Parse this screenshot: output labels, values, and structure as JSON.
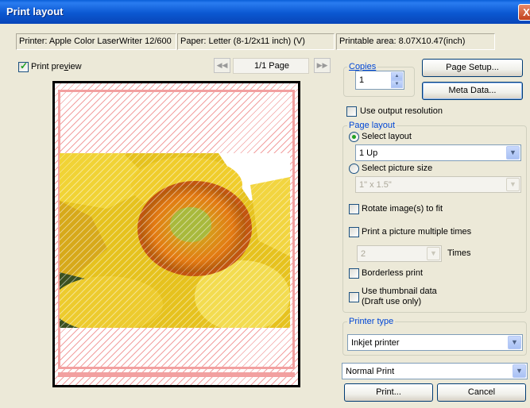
{
  "window": {
    "title": "Print layout",
    "close_glyph": "X"
  },
  "info": {
    "printer": "Printer: Apple Color LaserWriter 12/600",
    "paper": "Paper: Letter (8-1/2x11 inch) (V)",
    "printable": "Printable area: 8.07X10.47(inch)"
  },
  "preview": {
    "checkbox_label_prefix": "Print pre",
    "checkbox_label_u": "v",
    "checkbox_label_suffix": "iew",
    "checked": true,
    "page_indicator": "1/1 Page",
    "first_glyph": "◀◀",
    "next_glyph": "▶▶"
  },
  "copies": {
    "label": "Copies",
    "label_u": "C",
    "value": "1"
  },
  "buttons": {
    "page_setup": "Page Setup...",
    "meta_data": "Meta Data...",
    "print": "Print...",
    "cancel": "Cancel"
  },
  "use_output_resolution": {
    "label": "Use output resolution",
    "checked": false
  },
  "page_layout": {
    "group_label": "Page layout",
    "select_layout_label": "Select layout",
    "layout_value": "1 Up",
    "select_size_label": "Select picture size",
    "size_value": "1\" x 1.5\"",
    "rotate_label": "Rotate image(s) to fit",
    "multiple_label": "Print a picture multiple times",
    "times_value": "2",
    "times_label": "Times",
    "borderless_label": "Borderless print",
    "thumbnail_label": "Use thumbnail data",
    "thumbnail_sub": "(Draft use only)"
  },
  "printer_type": {
    "group_label": "Printer type",
    "value": "Inkjet printer"
  },
  "print_mode": {
    "value": "Normal Print"
  },
  "colors": {
    "titlebar": "#0b58d2",
    "dialog_bg": "#ece9d8",
    "group_label": "#0046d5",
    "hatch": "#f2a0a0"
  }
}
